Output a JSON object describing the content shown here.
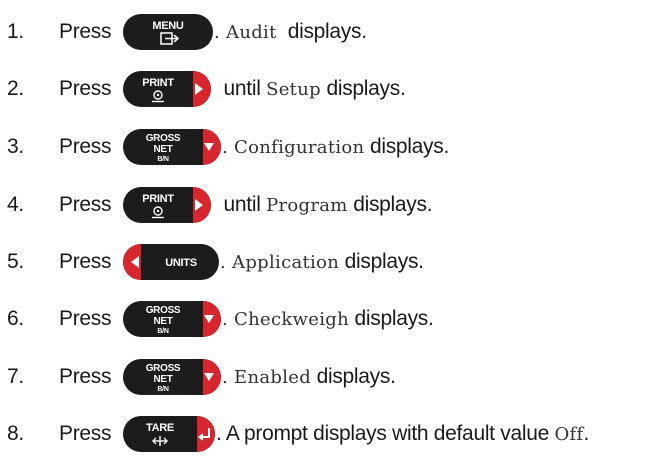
{
  "press_label": "Press",
  "steps": [
    {
      "num": "1.",
      "key": {
        "type": "menu",
        "line1": "MENU",
        "line2": "↦"
      },
      "segments": [
        ". ",
        "Audit",
        "  displays."
      ]
    },
    {
      "num": "2.",
      "key": {
        "type": "print",
        "line1": "PRINT",
        "line2": "⊙"
      },
      "segments": [
        " until ",
        "Setup",
        " displays."
      ]
    },
    {
      "num": "3.",
      "key": {
        "type": "gross",
        "line1": "GROSS",
        "line2": "NET",
        "line3": "B/N"
      },
      "segments": [
        ". ",
        "Configuration",
        " displays."
      ]
    },
    {
      "num": "4.",
      "key": {
        "type": "print",
        "line1": "PRINT",
        "line2": "⊙"
      },
      "segments": [
        " until ",
        "Program",
        " displays."
      ]
    },
    {
      "num": "5.",
      "key": {
        "type": "units",
        "line1": "UNITS"
      },
      "segments": [
        ". ",
        "Application",
        " displays."
      ]
    },
    {
      "num": "6.",
      "key": {
        "type": "gross",
        "line1": "GROSS",
        "line2": "NET",
        "line3": "B/N"
      },
      "segments": [
        ". ",
        "Checkweigh",
        " displays."
      ]
    },
    {
      "num": "7.",
      "key": {
        "type": "gross",
        "line1": "GROSS",
        "line2": "NET",
        "line3": "B/N"
      },
      "segments": [
        ". ",
        "Enabled",
        " displays."
      ]
    },
    {
      "num": "8.",
      "key": {
        "type": "tare",
        "line1": "TARE",
        "line2": "↔"
      },
      "segments": [
        ". A prompt displays with default value ",
        "Off",
        "."
      ]
    }
  ],
  "colors": {
    "key_body": "#1c1c1c",
    "arrow_red": "#d7262e",
    "key_text": "#ffffff"
  }
}
